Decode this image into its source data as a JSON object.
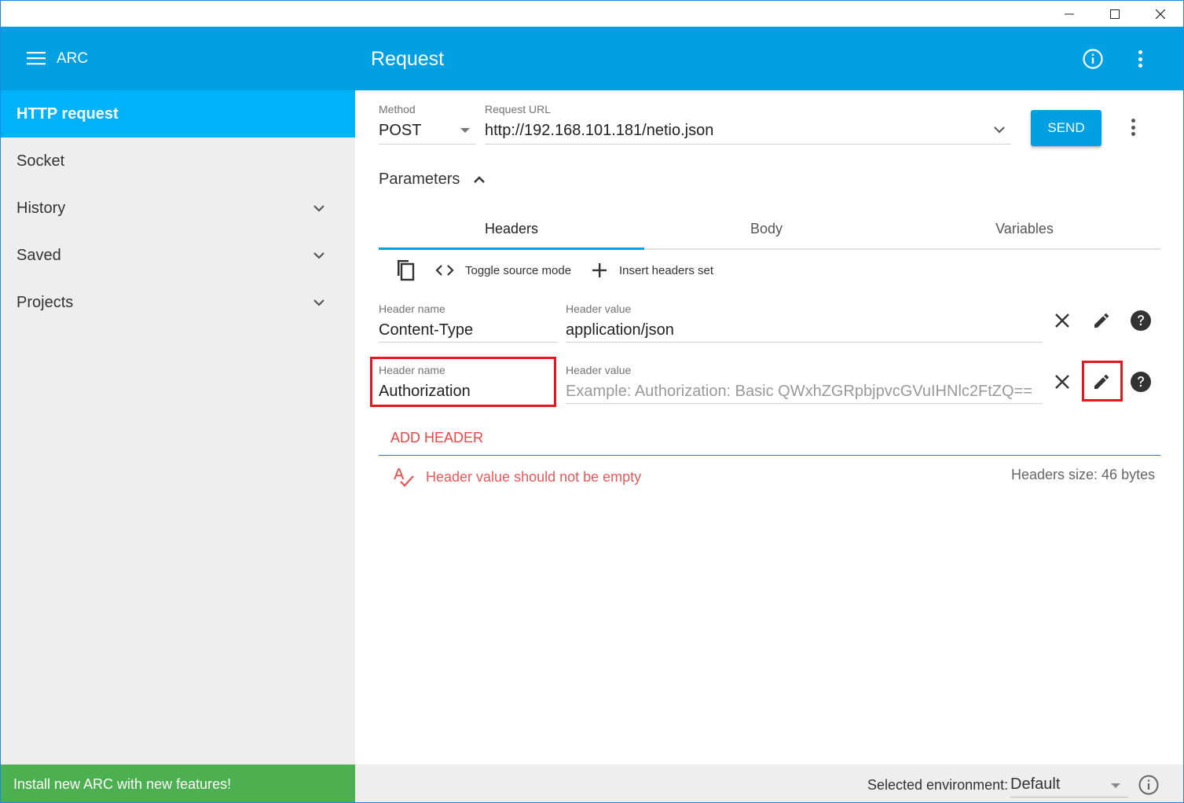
{
  "app": {
    "name": "ARC",
    "page_title": "Request"
  },
  "sidebar": {
    "items": [
      {
        "label": "HTTP request",
        "active": true,
        "expandable": false
      },
      {
        "label": "Socket",
        "active": false,
        "expandable": false
      },
      {
        "label": "History",
        "active": false,
        "expandable": true
      },
      {
        "label": "Saved",
        "active": false,
        "expandable": true
      },
      {
        "label": "Projects",
        "active": false,
        "expandable": true
      }
    ],
    "promo": "Install new ARC with new features!"
  },
  "request": {
    "method_label": "Method",
    "method_value": "POST",
    "url_label": "Request URL",
    "url_value": "http://192.168.101.181/netio.json",
    "send_label": "SEND"
  },
  "parameters": {
    "label": "Parameters",
    "tabs": [
      {
        "label": "Headers",
        "active": true
      },
      {
        "label": "Body",
        "active": false
      },
      {
        "label": "Variables",
        "active": false
      }
    ],
    "toolbar": {
      "toggle_source": "Toggle source mode",
      "insert_set": "Insert headers set"
    },
    "headers": [
      {
        "name_label": "Header name",
        "name_value": "Content-Type",
        "value_label": "Header value",
        "value_value": "application/json",
        "value_placeholder": ""
      },
      {
        "name_label": "Header name",
        "name_value": "Authorization",
        "value_label": "Header value",
        "value_value": "",
        "value_placeholder": "Example: Authorization: Basic QWxhZGRpbjpvcGVuIHNlc2FtZQ=="
      }
    ],
    "add_header": "ADD HEADER",
    "error": "Header value should not be empty",
    "headers_size": "Headers size: 46 bytes"
  },
  "footer": {
    "env_label": "Selected environment:",
    "env_value": "Default"
  },
  "colors": {
    "primary": "#00a0e3",
    "active_nav": "#00b3f9",
    "promo": "#4caf50",
    "error": "#e45b5b",
    "highlight_box": "#e8161d"
  }
}
